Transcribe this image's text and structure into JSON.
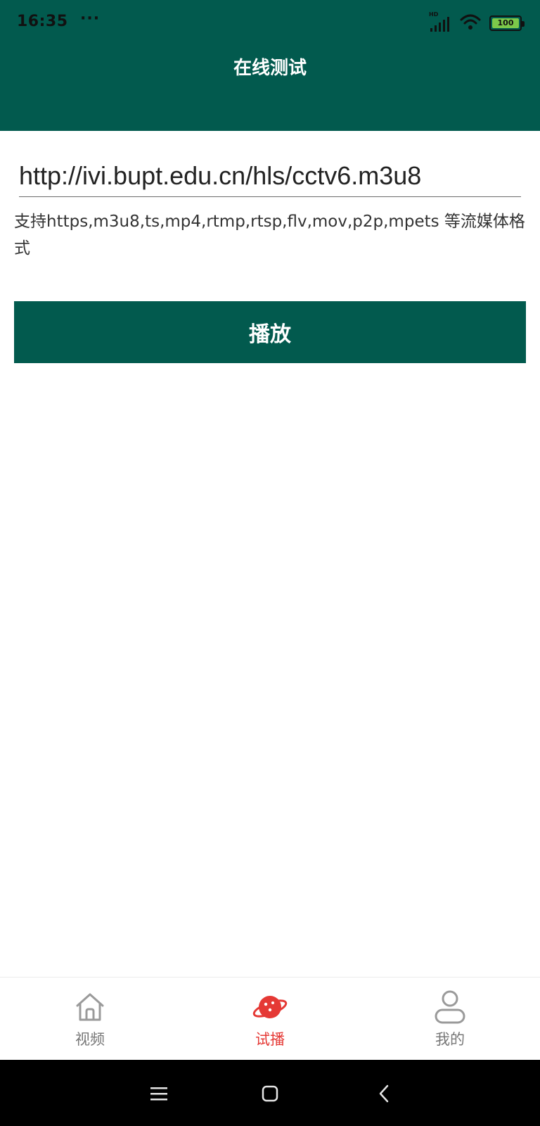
{
  "status_bar": {
    "time": "16:35",
    "dots": "···",
    "hd": "HD",
    "battery": "100"
  },
  "header": {
    "title": "在线测试"
  },
  "url_input": {
    "value": "http://ivi.bupt.edu.cn/hls/cctv6.m3u8"
  },
  "hint": "支持https,m3u8,ts,mp4,rtmp,rtsp,flv,mov,p2p,mpets 等流媒体格式",
  "play_button": {
    "label": "播放"
  },
  "tabs": [
    {
      "label": "视频",
      "icon": "home-icon",
      "active": false
    },
    {
      "label": "试播",
      "icon": "planet-icon",
      "active": true
    },
    {
      "label": "我的",
      "icon": "person-icon",
      "active": false
    }
  ],
  "nav": {
    "icons": [
      "menu-icon",
      "home-square-icon",
      "back-icon"
    ]
  },
  "colors": {
    "primary": "#025a4e",
    "active_tab": "#e53935",
    "inactive_tab": "#777777"
  }
}
